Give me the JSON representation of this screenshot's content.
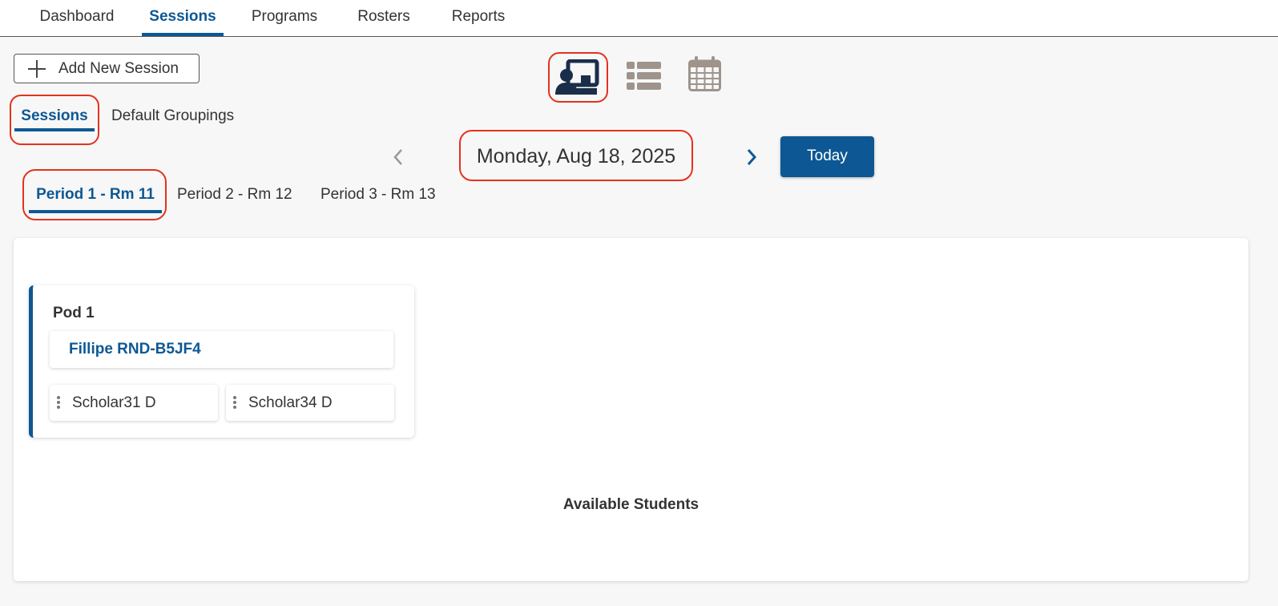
{
  "nav": {
    "items": [
      {
        "label": "Dashboard"
      },
      {
        "label": "Sessions"
      },
      {
        "label": "Programs"
      },
      {
        "label": "Rosters"
      },
      {
        "label": "Reports"
      }
    ],
    "active": "Sessions"
  },
  "toolbar": {
    "add_session_label": "Add New Session",
    "views": [
      "classroom-view-icon",
      "list-view-icon",
      "calendar-view-icon"
    ],
    "active_view": "classroom-view-icon"
  },
  "subtabs": [
    {
      "label": "Sessions"
    },
    {
      "label": "Default Groupings"
    }
  ],
  "date_nav": {
    "date": "Monday, Aug 18, 2025",
    "today_label": "Today"
  },
  "periods": [
    {
      "label": "Period 1 - Rm 11"
    },
    {
      "label": "Period 2 - Rm 12"
    },
    {
      "label": "Period 3 - Rm 13"
    }
  ],
  "pod": {
    "title": "Pod 1",
    "leader": "Fillipe RND-B5JF4",
    "students": [
      "Scholar31 D",
      "Scholar34 D"
    ]
  },
  "available_students_label": "Available Students",
  "colors": {
    "accent": "#0d5894",
    "highlight": "#e4321e",
    "inactive_icon": "#9e948c"
  }
}
